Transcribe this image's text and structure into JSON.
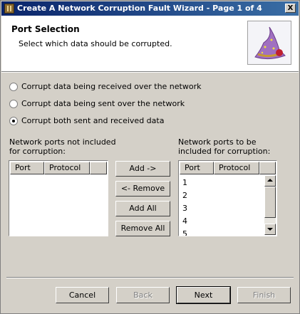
{
  "window": {
    "title": "Create A Network Corruption Fault Wizard - Page 1 of 4",
    "close_glyph": "X"
  },
  "header": {
    "heading": "Port Selection",
    "subheading": "Select which data should be corrupted."
  },
  "options": [
    {
      "label": "Corrupt data being received over the network",
      "selected": false
    },
    {
      "label": "Corrupt data being sent over the network",
      "selected": false
    },
    {
      "label": "Corrupt both sent and received data",
      "selected": true
    }
  ],
  "left_list": {
    "label_line1": "Network ports not included",
    "label_line2": "for corruption:",
    "columns": [
      "Port",
      "Protocol"
    ],
    "rows": []
  },
  "right_list": {
    "label_line1": "Network ports to be",
    "label_line2": "included for corruption:",
    "columns": [
      "Port",
      "Protocol"
    ],
    "rows": [
      "1",
      "2",
      "3",
      "4",
      "5"
    ]
  },
  "transfer_buttons": {
    "add": "Add ->",
    "remove": "<- Remove",
    "add_all": "Add All",
    "remove_all": "Remove All"
  },
  "footer": {
    "cancel": "Cancel",
    "back": "Back",
    "next": "Next",
    "finish": "Finish"
  },
  "colors": {
    "title_start": "#0a246a",
    "title_end": "#3a6ea5",
    "face": "#d4d0c8"
  },
  "icons": {
    "app": "app-icon",
    "wizard": "wizard-hat-icon"
  }
}
